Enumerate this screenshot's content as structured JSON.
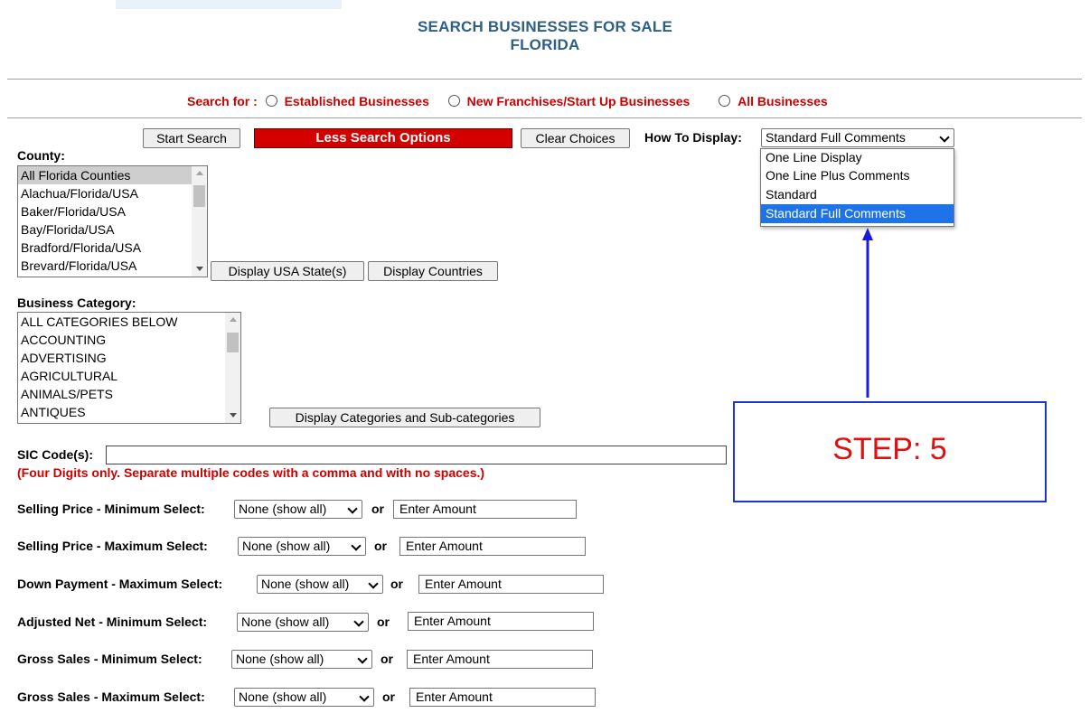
{
  "header": {
    "title_line1": "SEARCH BUSINESSES FOR SALE",
    "title_line2": "FLORIDA"
  },
  "search_for": {
    "label": "Search for :",
    "options": [
      "Established Businesses",
      "New Franchises/Start Up Businesses",
      "All Businesses"
    ]
  },
  "toolbar": {
    "start_search": "Start Search",
    "less_options": "Less Search Options",
    "clear_choices": "Clear Choices",
    "how_to_display_label": "How To Display:",
    "how_to_display_value": "Standard Full Comments"
  },
  "display_dropdown": {
    "options": [
      "One Line Display",
      "One Line Plus Comments",
      "Standard",
      "Standard Full Comments"
    ],
    "highlighted": "Standard Full Comments"
  },
  "county": {
    "label": "County:",
    "items": [
      "All Florida Counties",
      "Alachua/Florida/USA",
      "Baker/Florida/USA",
      "Bay/Florida/USA",
      "Bradford/Florida/USA",
      "Brevard/Florida/USA"
    ],
    "display_states": "Display USA State(s)",
    "display_countries": "Display Countries"
  },
  "category": {
    "label": "Business Category:",
    "items": [
      "ALL CATEGORIES BELOW",
      "ACCOUNTING",
      "ADVERTISING",
      "AGRICULTURAL",
      "ANIMALS/PETS",
      "ANTIQUES"
    ],
    "display_button": "Display Categories and Sub-categories"
  },
  "sic": {
    "label": "SIC Code(s):",
    "value": "",
    "hint": "(Four Digits only.  Separate multiple codes with a comma and with no spaces.)"
  },
  "filters": [
    {
      "label": "Selling Price - Minimum Select:",
      "select": "None (show all)",
      "or": "or",
      "amount": "Enter Amount"
    },
    {
      "label": "Selling Price - Maximum Select:",
      "select": "None (show all)",
      "or": "or",
      "amount": "Enter Amount"
    },
    {
      "label": "Down Payment - Maximum Select:",
      "select": "None (show all)",
      "or": "or",
      "amount": "Enter Amount"
    },
    {
      "label": "Adjusted Net - Minimum Select:",
      "select": "None (show all)",
      "or": "or",
      "amount": "Enter Amount"
    },
    {
      "label": "Gross Sales - Minimum Select:",
      "select": "None (show all)",
      "or": "or",
      "amount": "Enter Amount"
    },
    {
      "label": "Gross Sales - Maximum Select:",
      "select": "None (show all)",
      "or": "or",
      "amount": "Enter Amount"
    }
  ],
  "annotation": {
    "step_text": "STEP: 5",
    "arrow_color": "#1a1adc"
  },
  "colors": {
    "title": "#2e5f86",
    "accent_red": "#cc0000",
    "highlight_blue": "#1e73e8"
  }
}
